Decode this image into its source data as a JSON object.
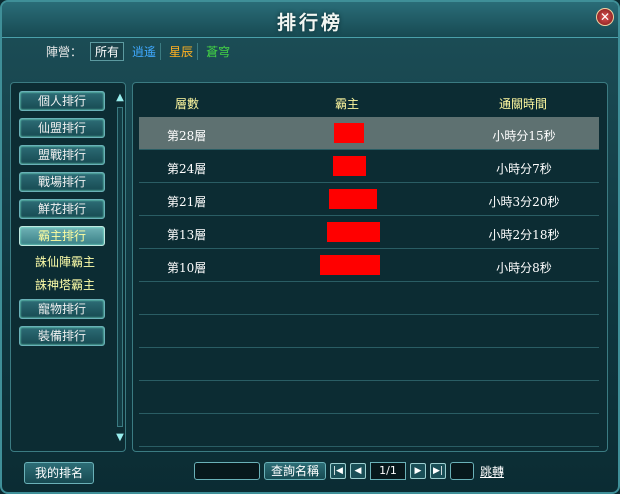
{
  "window": {
    "title": "排行榜",
    "close_glyph": "✕"
  },
  "camp": {
    "label": "陣營：",
    "options": [
      {
        "text": "所有",
        "color": "#ffffff",
        "active": true
      },
      {
        "text": "逍遙",
        "color": "#3fa9ff"
      },
      {
        "text": "星辰",
        "color": "#ffb020"
      },
      {
        "text": "蒼穹",
        "color": "#44d444"
      }
    ]
  },
  "sidebar": {
    "items": [
      {
        "label": "個人排行"
      },
      {
        "label": "仙盟排行"
      },
      {
        "label": "盟戰排行"
      },
      {
        "label": "戰場排行"
      },
      {
        "label": "鮮花排行"
      },
      {
        "label": "霸主排行",
        "active": true
      }
    ],
    "subitems": [
      "誅仙陣霸主",
      "誅神塔霸主"
    ],
    "items_after": [
      {
        "label": "寵物排行"
      },
      {
        "label": "裝備排行"
      }
    ]
  },
  "table": {
    "headers": {
      "level": "層數",
      "lord": "霸主",
      "time": "通關時間"
    },
    "rows": [
      {
        "level": "第28層",
        "time": "小時分15秒",
        "selected": true
      },
      {
        "level": "第24層",
        "time": "小時分7秒"
      },
      {
        "level": "第21層",
        "time": "小時3分20秒"
      },
      {
        "level": "第13層",
        "time": "小時2分18秒"
      },
      {
        "level": "第10層",
        "time": "小時分8秒"
      }
    ]
  },
  "footer": {
    "my_rank_label": "我的排名",
    "search_label": "查詢名稱",
    "page_indicator": "1/1",
    "jump_label": "跳轉"
  }
}
